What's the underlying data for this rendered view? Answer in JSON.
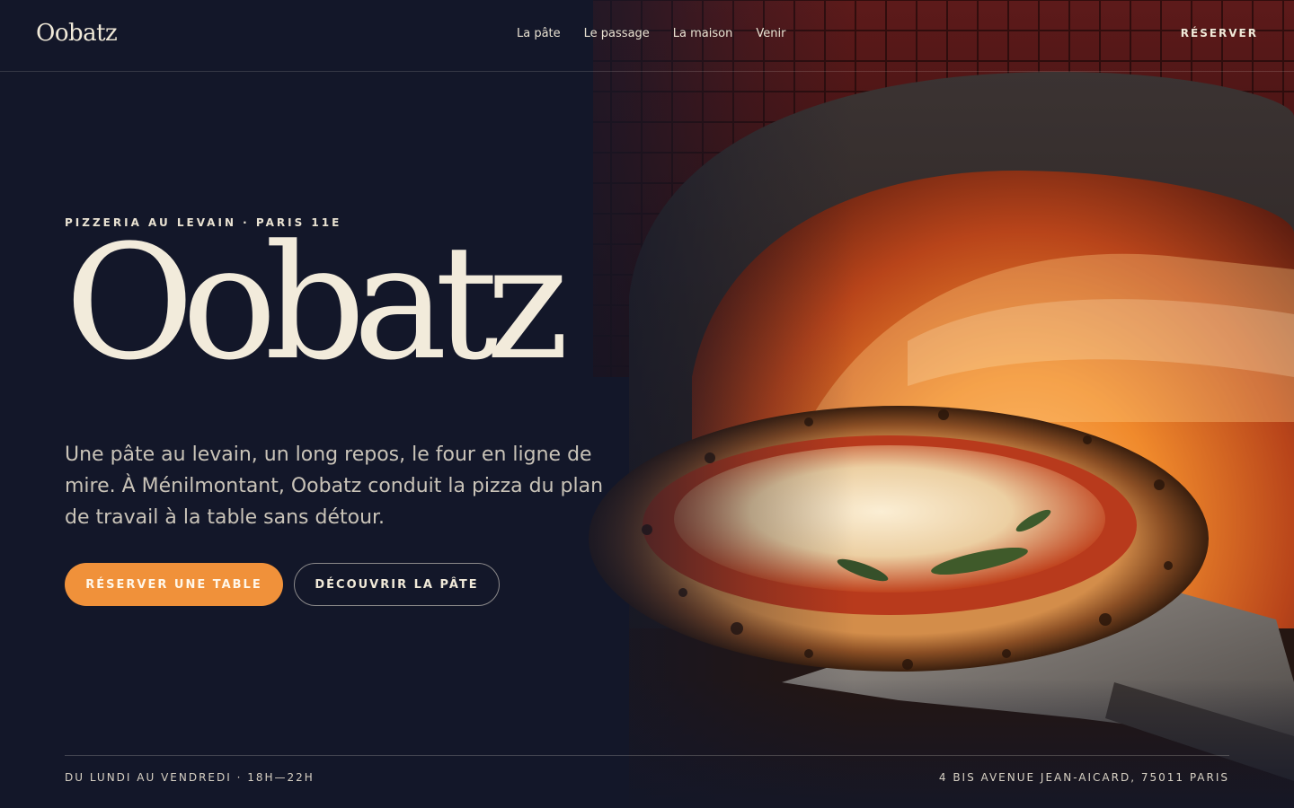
{
  "header": {
    "logo": "Oobatz",
    "nav": [
      {
        "label": "La pâte"
      },
      {
        "label": "Le passage"
      },
      {
        "label": "La maison"
      },
      {
        "label": "Venir"
      }
    ],
    "cta_label": "RÉSERVER"
  },
  "hero": {
    "eyebrow": "PIZZERIA AU LEVAIN · PARIS 11E",
    "title": "Oobatz",
    "lede": "Une pâte au levain, un long repos, le four en ligne de mire. À Ménilmontant, Oobatz conduit la pizza du plan de travail à la table sans détour.",
    "primary_button": "RÉSERVER UNE TABLE",
    "secondary_button": "DÉCOUVRIR LA PÂTE",
    "image": "wood-fired-oven-pizza-photo"
  },
  "footer": {
    "hours": "DU LUNDI AU VENDREDI · 18H—22H",
    "address": "4 BIS AVENUE JEAN-AICARD, 75011 PARIS"
  },
  "colors": {
    "background": "#131729",
    "cream": "#F2EBDB",
    "accent": "#F0913A"
  }
}
